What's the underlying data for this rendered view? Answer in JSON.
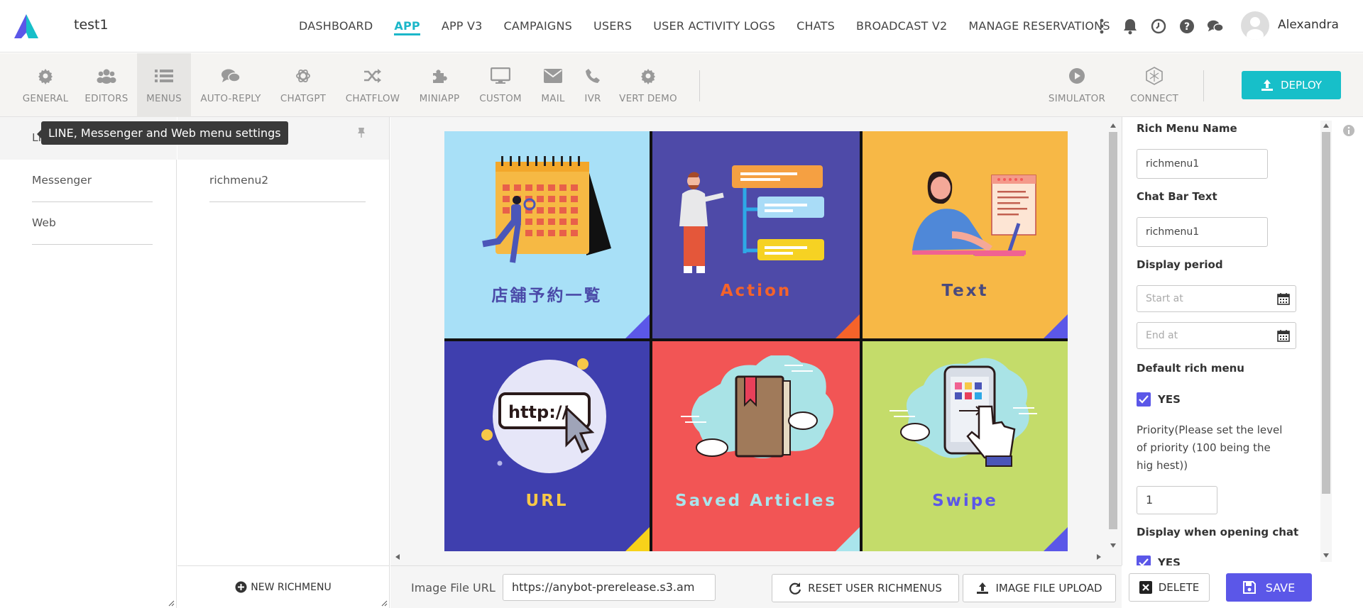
{
  "app": {
    "name": "test1",
    "user_name": "Alexandra"
  },
  "nav": [
    {
      "label": "DASHBOARD",
      "active": false
    },
    {
      "label": "APP",
      "active": true
    },
    {
      "label": "APP V3",
      "active": false
    },
    {
      "label": "CAMPAIGNS",
      "active": false
    },
    {
      "label": "USERS",
      "active": false
    },
    {
      "label": "USER ACTIVITY LOGS",
      "active": false
    },
    {
      "label": "CHATS",
      "active": false
    },
    {
      "label": "BROADCAST V2",
      "active": false
    },
    {
      "label": "MANAGE RESERVATIONS",
      "active": false
    }
  ],
  "top_icons": [
    "more-vertical-icon",
    "bell-icon",
    "clock-icon",
    "help-icon",
    "chat-bubbles-icon"
  ],
  "toolbar": {
    "items": [
      {
        "label": "GENERAL",
        "icon": "gear-icon"
      },
      {
        "label": "EDITORS",
        "icon": "users-icon"
      },
      {
        "label": "MENUS",
        "icon": "list-icon",
        "active": true
      },
      {
        "label": "AUTO-REPLY",
        "icon": "comments-icon"
      },
      {
        "label": "CHATGPT",
        "icon": "openai-icon"
      },
      {
        "label": "CHATFLOW",
        "icon": "shuffle-icon"
      },
      {
        "label": "MINIAPP",
        "icon": "puzzle-icon"
      },
      {
        "label": "CUSTOM",
        "icon": "monitor-icon"
      },
      {
        "label": "MAIL",
        "icon": "envelope-icon"
      },
      {
        "label": "IVR",
        "icon": "phone-icon"
      },
      {
        "label": "VERT DEMO",
        "icon": "gear-icon"
      }
    ],
    "simulator_label": "SIMULATOR",
    "connect_label": "CONNECT",
    "deploy_label": "DEPLOY"
  },
  "tooltip": "LINE, Messenger and Web menu settings",
  "channels": [
    "LINE",
    "Messenger",
    "Web"
  ],
  "richmenus": [
    "richmenu1",
    "richmenu2"
  ],
  "new_richmenu_label": "NEW RICHMENU",
  "richmenu_tiles": [
    {
      "caption": "店舗予約一覧",
      "bg": "#a8e0f7",
      "caption_color": "#4a4aa8",
      "corner": "#5b57e8"
    },
    {
      "caption": "Action",
      "bg": "#4e4aa8",
      "caption_color": "#f5632a",
      "corner": "#f5632a"
    },
    {
      "caption": "Text",
      "bg": "#f7b846",
      "caption_color": "#4a4a7e",
      "corner": "#5b57e8"
    },
    {
      "caption": "URL",
      "bg": "#3f3fae",
      "caption_color": "#f7c848",
      "corner": "#f7d21a"
    },
    {
      "caption": "Saved Articles",
      "bg": "#f25555",
      "caption_color": "#a9e5ec",
      "corner": "#a9e5ec"
    },
    {
      "caption": "Swipe",
      "bg": "#c4dc6a",
      "caption_color": "#5b57e8",
      "corner": "#5b57e8"
    }
  ],
  "tile_texts": {
    "url_art": "http://"
  },
  "bottom": {
    "image_url_label": "Image File URL",
    "image_url_value": "https://anybot-prerelease.s3.am",
    "reset_label": "RESET USER RICHMENUS",
    "upload_label": "IMAGE FILE UPLOAD",
    "delete_label": "DELETE",
    "save_label": "SAVE"
  },
  "settings": {
    "name_label": "Rich Menu Name",
    "name_value": "richmenu1",
    "chatbar_label": "Chat Bar Text",
    "chatbar_value": "richmenu1",
    "period_label": "Display period",
    "start_placeholder": "Start at",
    "end_placeholder": "End at",
    "default_label": "Default rich menu",
    "default_value": "YES",
    "priority_label": "Priority(Please set the level of priority (100 being the hig hest))",
    "priority_value": "1",
    "display_open_label": "Display when opening chat",
    "display_open_value": "YES"
  },
  "colors": {
    "accent": "#1cb7c9",
    "primary": "#5b57e8",
    "deploy": "#17bfc9"
  }
}
